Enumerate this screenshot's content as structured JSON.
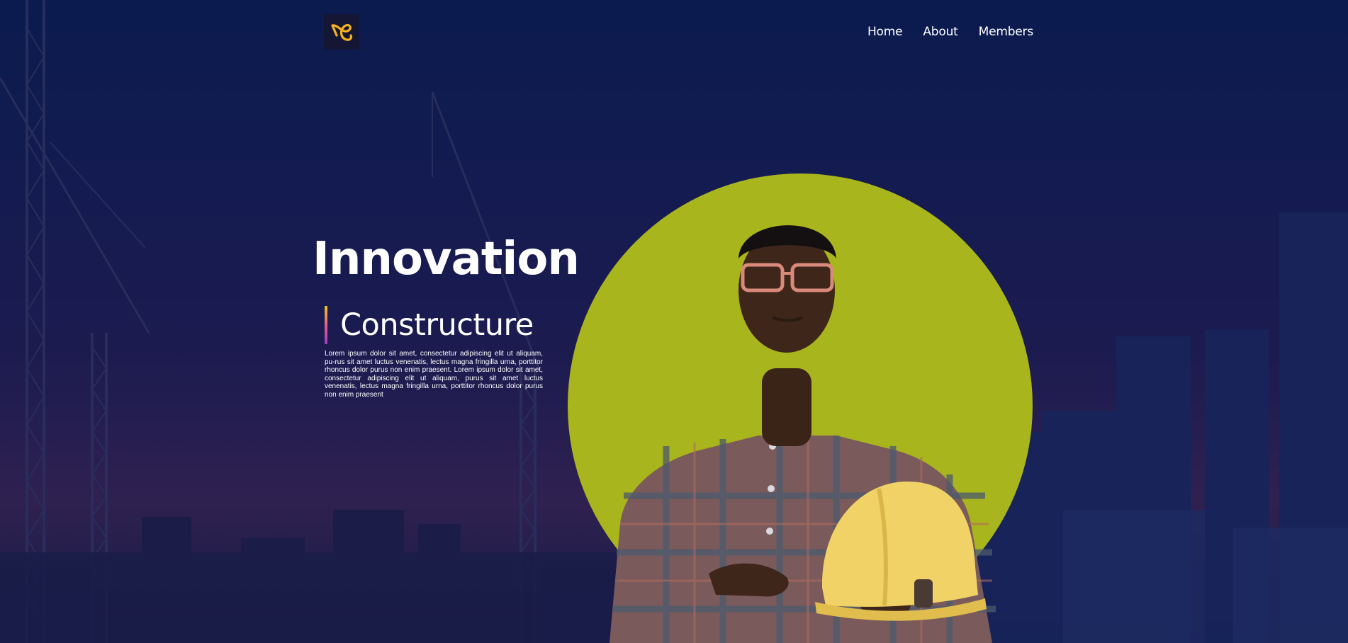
{
  "colors": {
    "background_top": "#0a1a4e",
    "background_bottom": "#241c4e",
    "accent_circle": "#a9b51c",
    "logo_accent": "#f5b31c",
    "text": "#ffffff",
    "bar_gradient": [
      "#f5c518",
      "#e05a8c",
      "#a13cc6"
    ]
  },
  "header": {
    "logo_icon": "ribbon-logo-icon",
    "nav": [
      {
        "label": "Home"
      },
      {
        "label": "About"
      },
      {
        "label": "Members"
      }
    ]
  },
  "hero": {
    "title": "Innovation",
    "subtitle": "Constructure",
    "body": "Lorem ipsum dolor sit amet, consectetur adipiscing elit ut aliquam, pu-rus sit amet luctus venenatis, lectus magna fringilla urna, porttitor rhoncus dolor purus non enim praesent. Lorem ipsum dolor sit amet, consectetur adipiscing elit ut aliquam, purus sit amet luctus venenatis, lectus magna fringilla urna, porttitor rhoncus dolor purus non enim praesent"
  },
  "images": {
    "background": "construction-site-cranes-skyline",
    "person": "worker-holding-hard-hat"
  }
}
